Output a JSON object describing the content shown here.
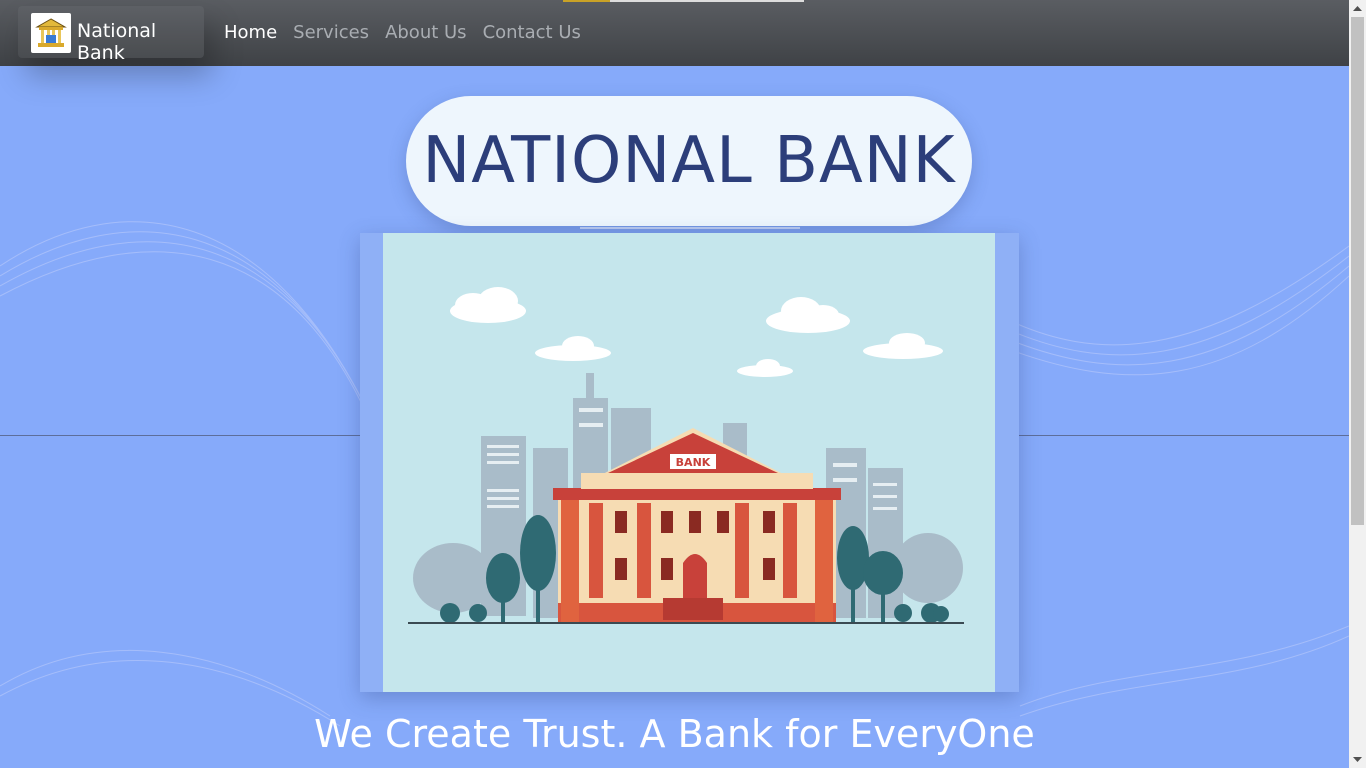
{
  "navbar": {
    "brand_name": "National Bank",
    "links": [
      {
        "label": "Home",
        "active": true
      },
      {
        "label": "Services",
        "active": false
      },
      {
        "label": "About Us",
        "active": false
      },
      {
        "label": "Contact Us",
        "active": false
      }
    ]
  },
  "hero": {
    "title": "NATIONAL BANK",
    "illustration_sign": "BANK",
    "tagline": "We Create Trust. A Bank for EveryOne"
  },
  "colors": {
    "background": "#86aafa",
    "navbar": "#4a4d52",
    "title_text": "#2c3e7a",
    "title_pill": "#eef6fd"
  }
}
